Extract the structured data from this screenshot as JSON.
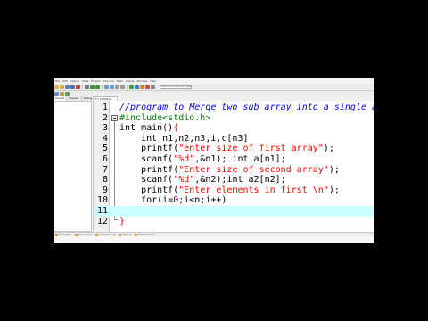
{
  "menubar": {
    "items": [
      "File",
      "Edit",
      "Search",
      "View",
      "Project",
      "Execute",
      "Tools",
      "AStyle",
      "Window",
      "Help"
    ]
  },
  "toolbar": {
    "compiler_select": "TDM-GCC 4.9.2 64-bit Release"
  },
  "left_panel": {
    "tabs": [
      "Project",
      "Classes",
      "Debug"
    ]
  },
  "editor": {
    "file_tab": "[*] Untitled1",
    "lines": [
      {
        "n": "1",
        "tokens": [
          {
            "t": "//program to Merge two sub array into a single arr.:-",
            "c": "cmt"
          }
        ]
      },
      {
        "n": "2",
        "tokens": [
          {
            "t": "#include<stdio.h>",
            "c": "pre"
          }
        ]
      },
      {
        "n": "3",
        "tokens": [
          {
            "t": "int main()",
            "c": "kw"
          },
          {
            "t": "{",
            "c": "sym"
          }
        ]
      },
      {
        "n": "4",
        "tokens": [
          {
            "t": "    int n1,n2,n3,i,c[n3]",
            "c": "kw"
          }
        ]
      },
      {
        "n": "5",
        "tokens": [
          {
            "t": "    printf(",
            "c": "txt"
          },
          {
            "t": "\"enter size of first array\"",
            "c": "str"
          },
          {
            "t": ");",
            "c": "txt"
          }
        ]
      },
      {
        "n": "6",
        "tokens": [
          {
            "t": "    scanf(",
            "c": "txt"
          },
          {
            "t": "\"%d\"",
            "c": "str"
          },
          {
            "t": ",&n1); int a[n1];",
            "c": "txt"
          }
        ]
      },
      {
        "n": "7",
        "tokens": [
          {
            "t": "    printf(",
            "c": "txt"
          },
          {
            "t": "\"Enter size of second array\"",
            "c": "str"
          },
          {
            "t": ");",
            "c": "txt"
          }
        ]
      },
      {
        "n": "8",
        "tokens": [
          {
            "t": "    scanf(",
            "c": "txt"
          },
          {
            "t": "\"%d\"",
            "c": "str"
          },
          {
            "t": ",&n2);int a2[n2];",
            "c": "txt"
          }
        ]
      },
      {
        "n": "9",
        "tokens": [
          {
            "t": "    printf(",
            "c": "txt"
          },
          {
            "t": "\"Enter elements in first \\n\"",
            "c": "str"
          },
          {
            "t": ");",
            "c": "txt"
          }
        ]
      },
      {
        "n": "10",
        "tokens": [
          {
            "t": "    for(i=",
            "c": "txt"
          },
          {
            "t": "0",
            "c": "num"
          },
          {
            "t": ";i<n;i++)",
            "c": "txt"
          }
        ]
      },
      {
        "n": "11",
        "tokens": [
          {
            "t": "",
            "c": "txt"
          }
        ],
        "current": true
      },
      {
        "n": "12",
        "tokens": [
          {
            "t": "}",
            "c": "sym"
          }
        ]
      }
    ]
  },
  "bottom_tabs": [
    "Compiler",
    "Resources",
    "Compile Log",
    "Debug",
    "Find Results"
  ],
  "colors": {
    "comment": "#0000ff",
    "preprocessor": "#008000",
    "string": "#ff0000",
    "number": "#800080",
    "current_line": "#ccffff"
  }
}
